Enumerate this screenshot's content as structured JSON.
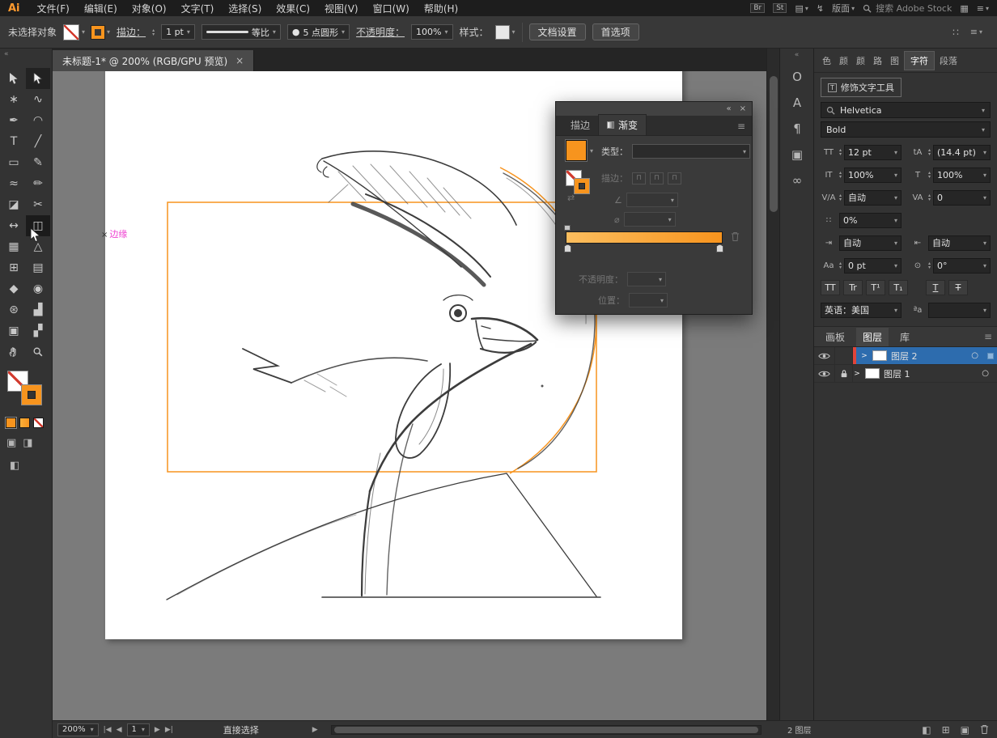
{
  "colors": {
    "accent": "#F7941E",
    "selection_blue": "#2D6CAE",
    "annotation_pink": "#EE3FD0"
  },
  "menubar": {
    "logo": "Ai",
    "items": [
      "文件(F)",
      "编辑(E)",
      "对象(O)",
      "文字(T)",
      "选择(S)",
      "效果(C)",
      "视图(V)",
      "窗口(W)",
      "帮助(H)"
    ],
    "br": "Br",
    "st": "St",
    "layout": "版面",
    "search": "搜索 Adobe Stock"
  },
  "controlbar": {
    "no_selection": "未选择对象",
    "stroke_label": "描边：",
    "stroke_width": "1 pt",
    "profile": "等比",
    "brush": "5 点圆形",
    "opacity_label": "不透明度：",
    "opacity": "100%",
    "style_label": "样式：",
    "document_setup": "文档设置",
    "preferences": "首选项"
  },
  "doc_tab": {
    "title": "未标题-1* @ 200% (RGB/GPU 预览)"
  },
  "canvas": {
    "annotation": "边缘"
  },
  "gradient_panel": {
    "tab_stroke": "描边",
    "tab_gradient": "渐变",
    "type_label": "类型：",
    "stroke_label": "描边：",
    "opacity_label": "不透明度：",
    "location_label": "位置："
  },
  "char_panel": {
    "tabs": [
      "色",
      "颜",
      "颜",
      "路",
      "图"
    ],
    "tab_character": "字符",
    "tab_paragraph": "段落",
    "touch_type": "修饰文字工具",
    "font_family": "Helvetica",
    "font_style": "Bold",
    "font_size": "12 pt",
    "leading": "(14.4 pt)",
    "v_scale": "100%",
    "h_scale": "100%",
    "kerning": "自动",
    "tracking": "0",
    "prop_spacing": "0%",
    "space_left": "自动",
    "space_right": "自动",
    "baseline": "0 pt",
    "rotation": "0°",
    "style_buttons": [
      "TT",
      "Tr",
      "T¹",
      "T₁",
      "T",
      "T"
    ],
    "language": "英语：美国",
    "aa": "ªa"
  },
  "layers_panel": {
    "tab_artboards": "画板",
    "tab_layers": "图层",
    "tab_libraries": "库",
    "layers": [
      {
        "name": "图层 2"
      },
      {
        "name": "图层 1"
      }
    ],
    "footer": "2 图层"
  },
  "statusbar": {
    "zoom": "200%",
    "page": "1",
    "tool": "直接选择"
  },
  "icons": {
    "chevron": "▾",
    "up": "▴",
    "down": "▾",
    "close": "×",
    "menu": "≡",
    "collapse": "«",
    "dots": "∷",
    "grid": "▦",
    "doc_profile": "▤",
    "gpu": "↯",
    "nav_first": "|◀",
    "nav_prev": "◀",
    "nav_next": "▶",
    "nav_last": "▶|",
    "play": "▶",
    "disclosure": ">",
    "target": "○",
    "brush_dot": "●",
    "wand": "∗",
    "lasso": "∿",
    "pen": "✒",
    "curvature": "◠",
    "type_tool": "T",
    "line": "╱",
    "rect": "▭",
    "paintbrush": "✎",
    "shaper": "≈",
    "pencil": "✏",
    "eraser": "◪",
    "scissors": "✂",
    "width": "↔",
    "shape_builder": "◫",
    "free_transform": "▦",
    "perspective": "△",
    "mesh": "⊞",
    "gradient": "▤",
    "eyedropper": "◆",
    "blend": "◉",
    "symbol_sprayer": "⊛",
    "graph": "▟",
    "artboard": "▣",
    "slice": "▞",
    "mask": "◧",
    "sublayer": "⊞",
    "newlayer": "▣",
    "draw_normal": "▣",
    "draw_behind": "◨",
    "screen_mode": "◧",
    "ic_size": "TT",
    "ic_leading": "tA",
    "ic_vscale": "IT",
    "ic_hscale": "T",
    "ic_kerning": "V/A",
    "ic_tracking": "VA",
    "ic_prop": "∷",
    "ic_space_l": "⇥",
    "ic_space_r": "⇤",
    "ic_baseline": "Aa",
    "ic_rotation": "⊙",
    "touch_type_icon": "T",
    "stroke_btn": "⊓",
    "angle": "∠",
    "aspect": "⌀",
    "reverse": "⇄",
    "anno_x": "×"
  }
}
